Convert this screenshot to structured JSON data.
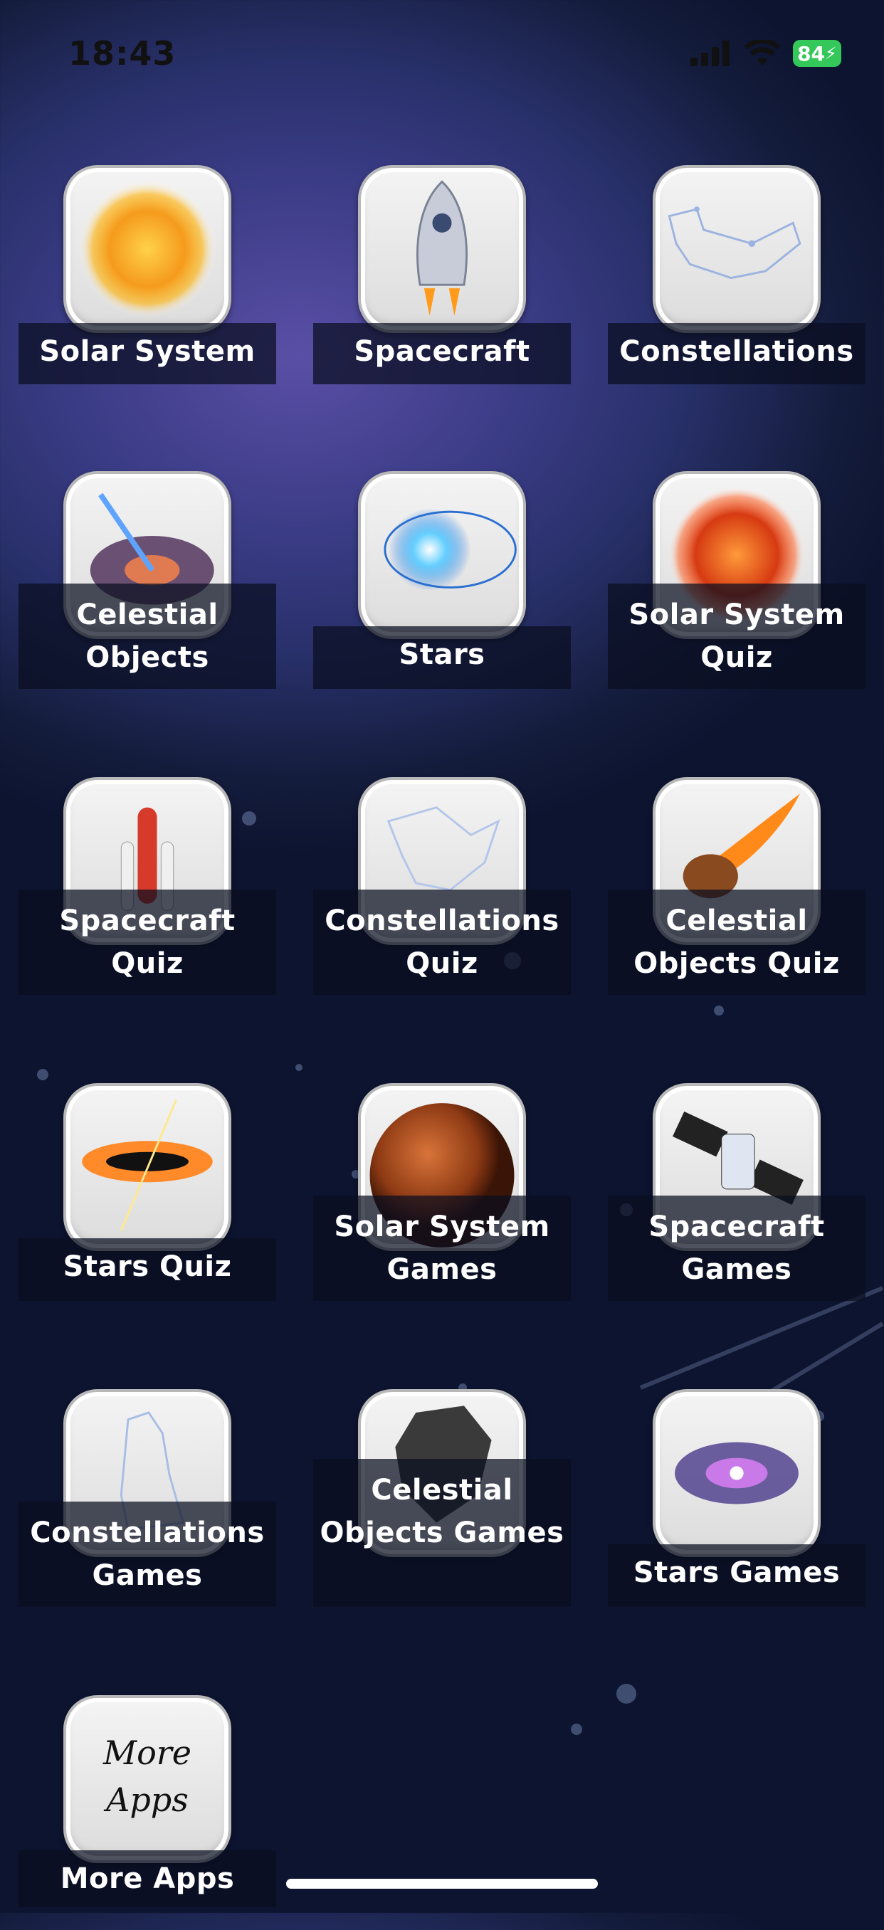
{
  "status_bar": {
    "time": "18:43",
    "battery": "84"
  },
  "tiles": [
    {
      "label": "Solar System",
      "icon": "sun-icon"
    },
    {
      "label": "Spacecraft",
      "icon": "capsule-icon"
    },
    {
      "label": "Constellations",
      "icon": "fox-constellation-icon"
    },
    {
      "label": "Celestial Objects",
      "icon": "comet-blackhole-icon"
    },
    {
      "label": "Stars",
      "icon": "neutron-star-icon"
    },
    {
      "label": "Solar System Quiz",
      "icon": "red-sun-icon"
    },
    {
      "label": "Spacecraft Quiz",
      "icon": "shuttle-icon"
    },
    {
      "label": "Constellations Quiz",
      "icon": "bird-constellation-icon"
    },
    {
      "label": "Celestial Objects Quiz",
      "icon": "meteor-icon"
    },
    {
      "label": "Stars Quiz",
      "icon": "accretion-disk-icon"
    },
    {
      "label": "Solar System Games",
      "icon": "mars-icon"
    },
    {
      "label": "Spacecraft Games",
      "icon": "satellite-icon"
    },
    {
      "label": "Constellations Games",
      "icon": "bear-constellation-icon"
    },
    {
      "label": "Celestial Objects Games",
      "icon": "asteroid-icon"
    },
    {
      "label": "Stars Games",
      "icon": "galaxy-icon"
    },
    {
      "label": "More Apps",
      "icon": "more-apps-icon",
      "icon_text": "More Apps"
    }
  ]
}
